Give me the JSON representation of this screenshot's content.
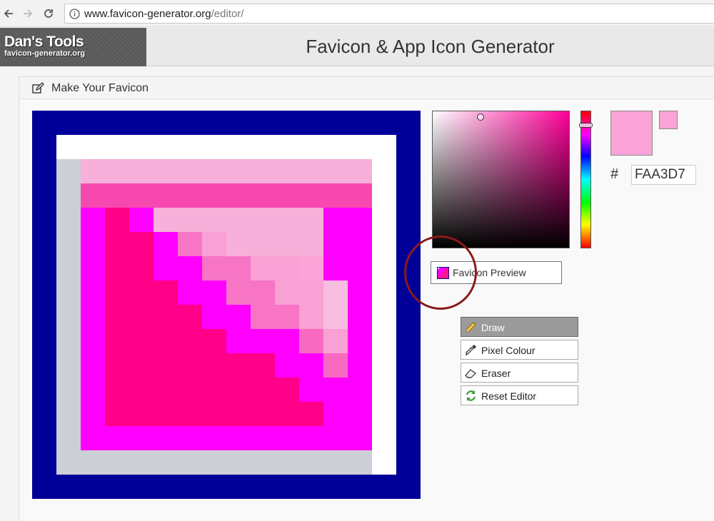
{
  "browser": {
    "url_host": "www.favicon-generator.org",
    "url_path": "/editor/"
  },
  "site": {
    "logo_title": "Dan's Tools",
    "logo_subtitle": "favicon-generator.org",
    "title": "Favicon & App Icon Generator"
  },
  "panel": {
    "title": "Make Your Favicon"
  },
  "palette": {
    "B": "#000099",
    "W": "#ffffff",
    "G": "#cdcfd6",
    "L": "#f7b0d9",
    "H": "#f748b0",
    "M": "#ff00ff",
    "D": "#ff0088",
    "P": "#f9a0d4",
    "Q": "#f874c5",
    "R": "#f86ac2",
    "S": "#fca3d7",
    "T": "#f7bde0"
  },
  "editor_pixels": [
    "BBBBBBBBBBBBBBBB",
    "BWWWWWWWWWWWWWWB",
    "BGLLLLLLLLLLLLWB",
    "BGHHHHHHHHHHHHWB",
    "BGMDMLLLLLLLMMWB",
    "BGMDDMQPLLLLMMWB",
    "BGMDDMMQQPPSMMWB",
    "BGMDDDMMQQPPTMWB",
    "BGMDDDDMMQQPTMWB",
    "BGMDDDDDMMMRPMWB",
    "BGMDDDDDDDMMRMWB",
    "BGMDDDDDDDDMMMWB",
    "BGMDDDDDDDDDMMWB",
    "BGMMMMMMMMMMMMWB",
    "BGGGGGGGGGGGGGWB",
    "BBBBBBBBBBBBBBBB"
  ],
  "color_picker": {
    "hex_value": "FAA3D7",
    "hash_symbol": "#",
    "selected_color": "#faa3d7"
  },
  "preview": {
    "label": "Favicon Preview"
  },
  "tools": [
    {
      "label": "Draw",
      "icon": "pencil-icon",
      "active": true
    },
    {
      "label": "Pixel Colour",
      "icon": "eyedropper-icon",
      "active": false
    },
    {
      "label": "Eraser",
      "icon": "eraser-icon",
      "active": false
    },
    {
      "label": "Reset Editor",
      "icon": "reset-icon",
      "active": false
    }
  ]
}
